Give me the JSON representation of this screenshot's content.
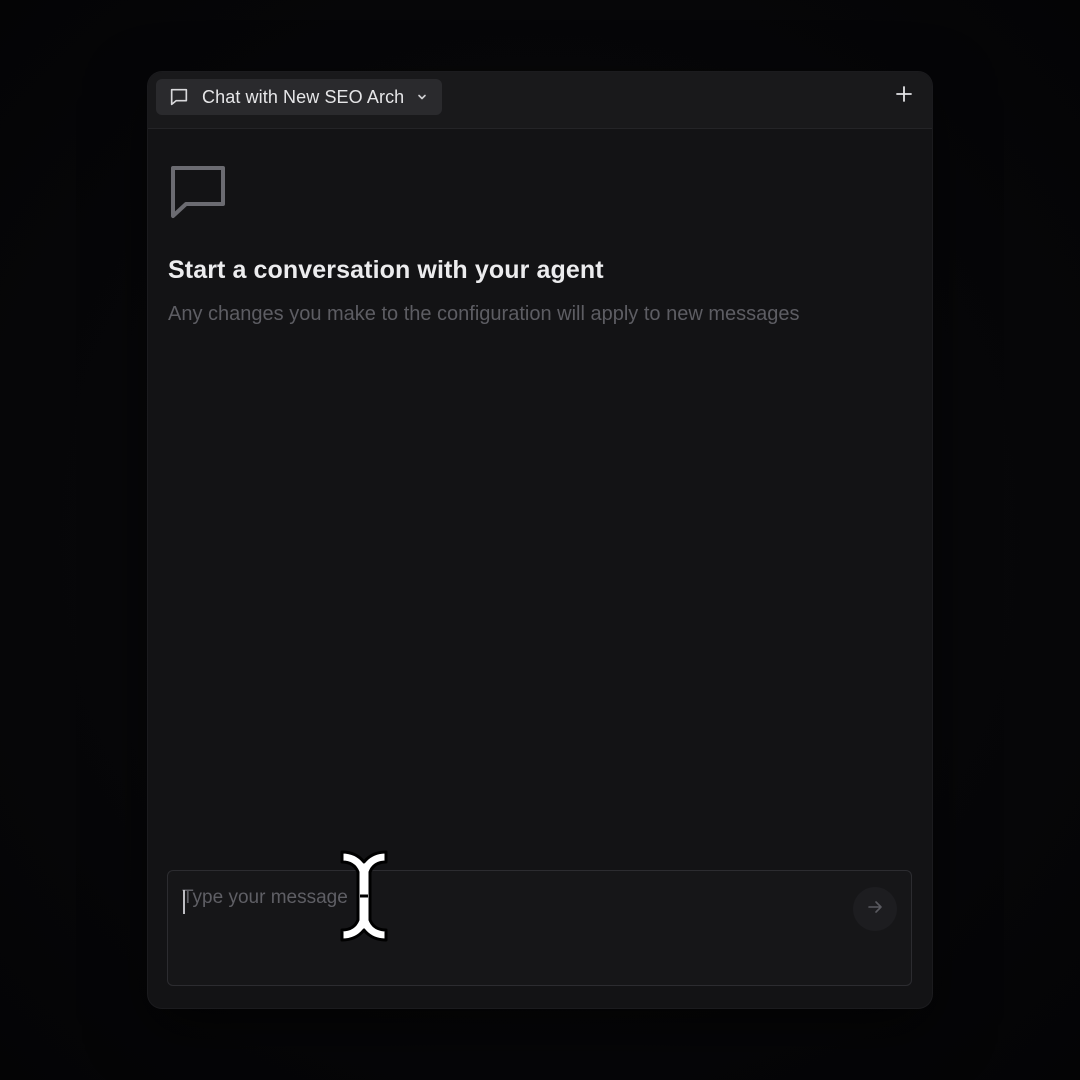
{
  "header": {
    "chat_title": "Chat with New SEO Arch",
    "chat_icon": "message-square-icon",
    "dropdown_icon": "chevron-down-icon",
    "new_chat_icon": "plus-icon"
  },
  "empty_state": {
    "icon": "message-square-icon",
    "title": "Start a conversation with your agent",
    "subtitle": "Any changes you make to the configuration will apply to new messages"
  },
  "composer": {
    "placeholder": "Type your message",
    "value": "",
    "send_icon": "arrow-right-icon"
  },
  "colors": {
    "panel_bg": "#131315",
    "topbar_bg": "#19191b",
    "selector_bg": "#2a2a2d",
    "title_text": "#ececee",
    "muted_text": "#5d5d63"
  }
}
